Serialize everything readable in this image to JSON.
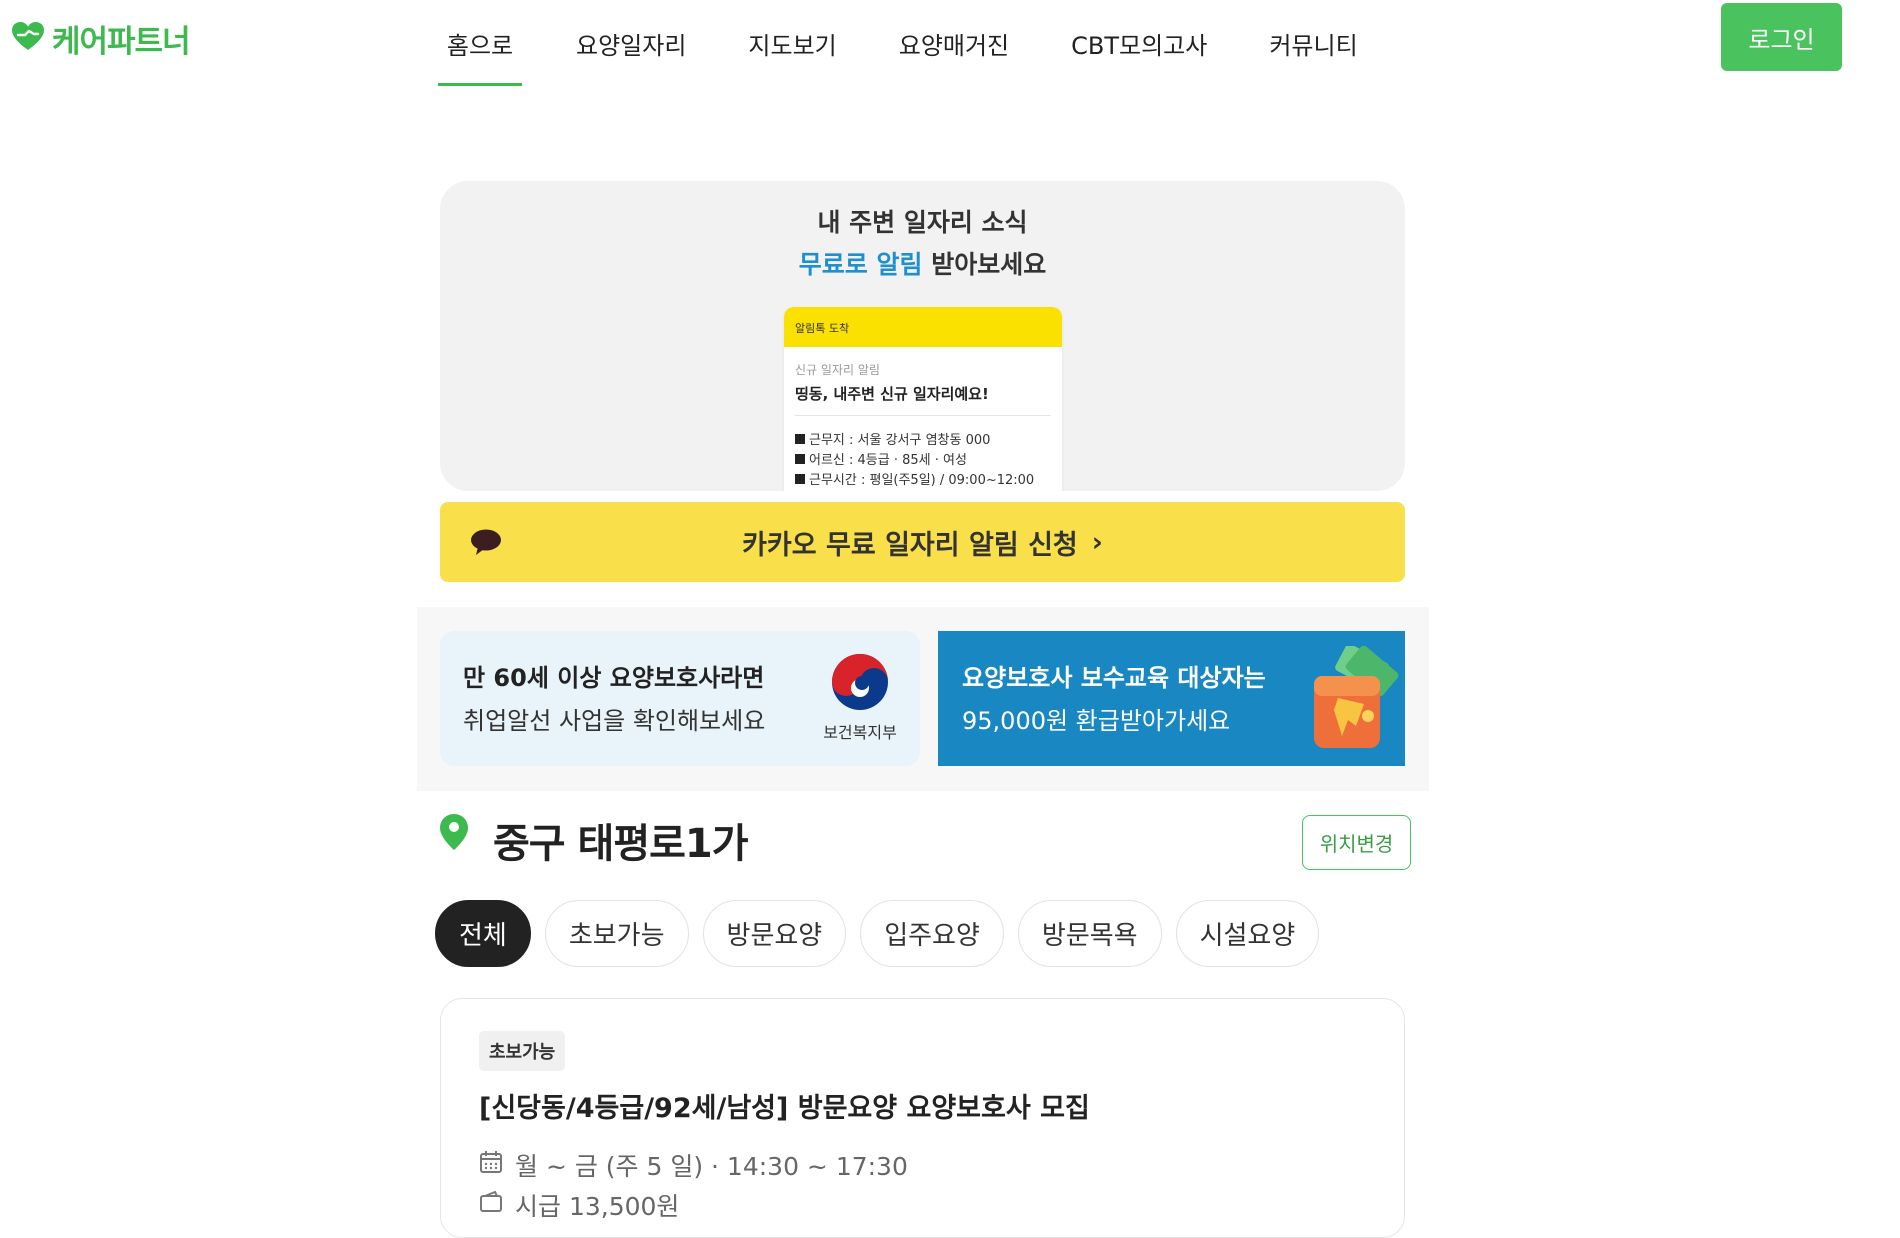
{
  "header": {
    "logo_text": "케어파트너",
    "nav": [
      "홈으로",
      "요양일자리",
      "지도보기",
      "요양매거진",
      "CBT모의고사",
      "커뮤니티"
    ],
    "active_nav": "홈으로",
    "login_label": "로그인",
    "brand_color": "#3dba4e"
  },
  "kakao_banner": {
    "line1": "내 주변 일자리 소식",
    "line2_highlight": "무료로 알림",
    "line2_rest": " 받아보세요",
    "preview": {
      "header": "알림톡 도착",
      "subtitle": "신규 일자리 알림",
      "title": "띵동, 내주변 신규 일자리예요!",
      "rows": [
        "근무지 : 서울 강서구 염창동 000",
        "어르신 : 4등급 · 85세 · 여성",
        "근무시간 : 평일(주5일) / 09:00~12:00"
      ]
    },
    "button_label": "카카오 무료 일자리 알림 신청",
    "button_chevron": "›",
    "accent_color": "#f9e04b"
  },
  "promos": [
    {
      "title": "만 60세 이상 요양보호사라면",
      "subtitle": "취업알선 사업을 확인해보세요",
      "logo_label": "보건복지부"
    },
    {
      "title": "요양보호사 보수교육 대상자는",
      "subtitle": "95,000원 환급받아가세요"
    }
  ],
  "location": {
    "name": "중구 태평로1가",
    "change_label": "위치변경"
  },
  "filters": {
    "items": [
      "전체",
      "초보가능",
      "방문요양",
      "입주요양",
      "방문목욕",
      "시설요양"
    ],
    "active": "전체"
  },
  "jobs": [
    {
      "tag": "초보가능",
      "title": "[신당동/4등급/92세/남성] 방문요양 요양보호사 모집",
      "schedule": "월 ~ 금 (주 5 일) · 14:30 ~ 17:30",
      "pay": "시급 13,500원"
    }
  ]
}
